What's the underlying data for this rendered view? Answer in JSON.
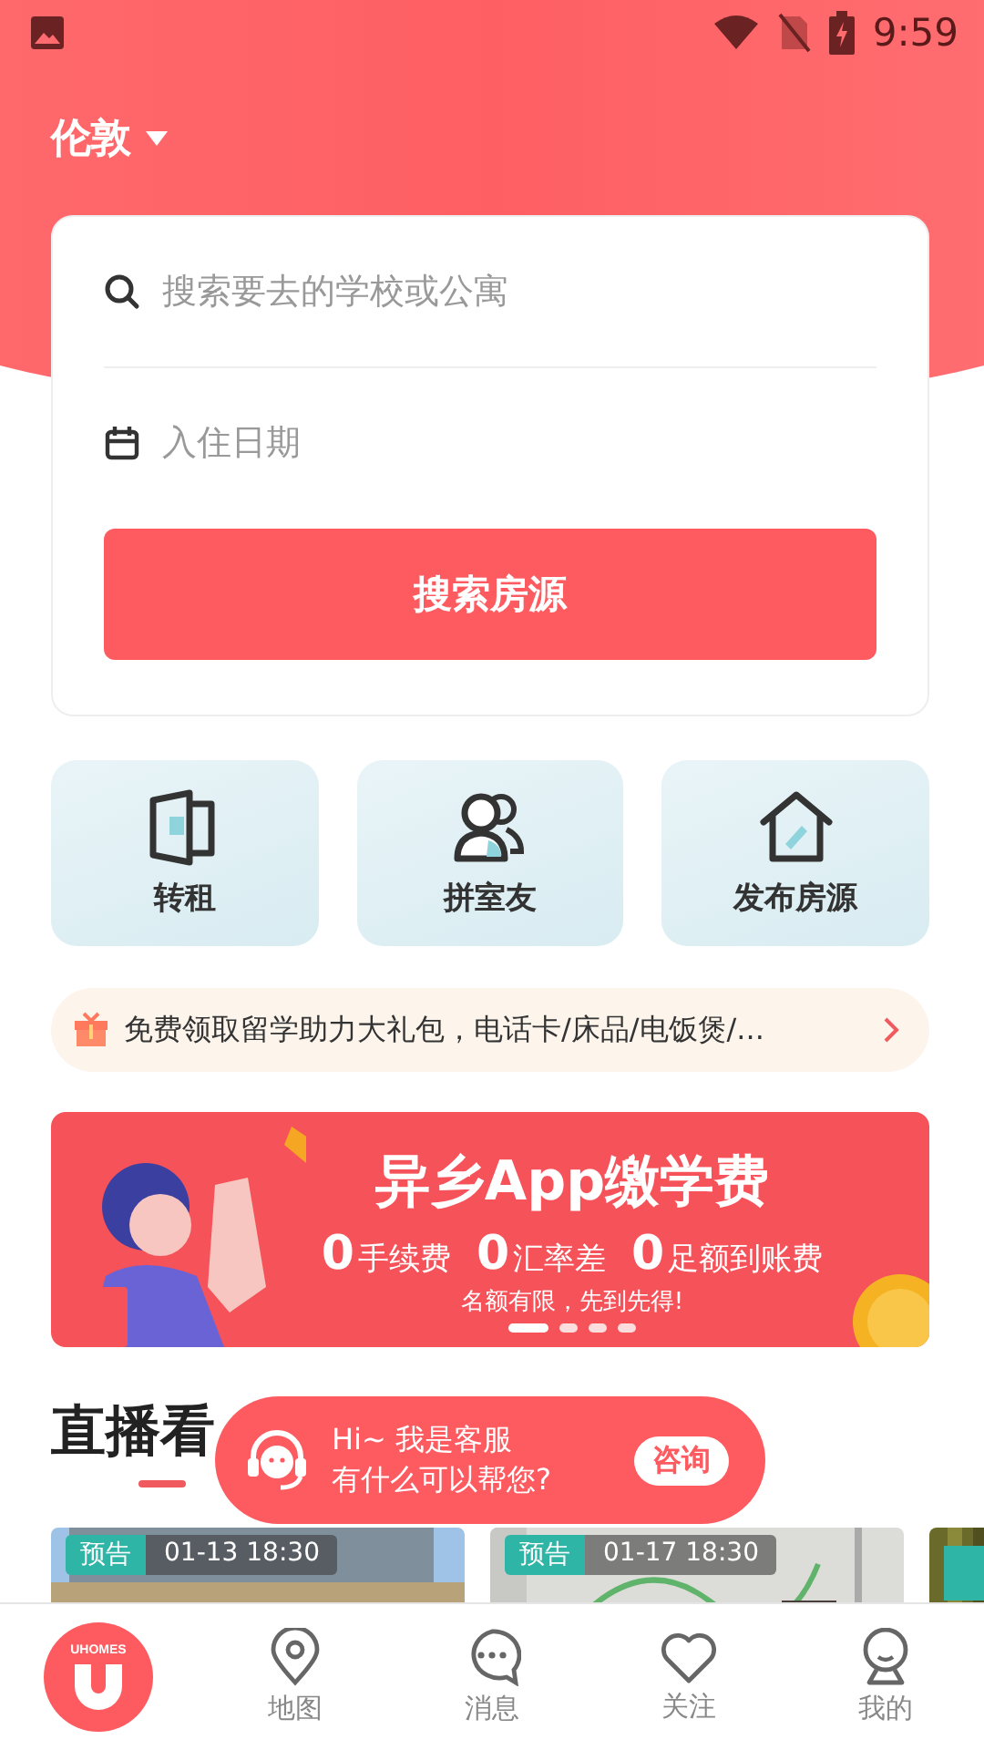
{
  "status_bar": {
    "time": "9:59"
  },
  "city": {
    "label": "伦敦"
  },
  "search": {
    "placeholder": "搜索要去的学校或公寓",
    "date_placeholder": "入住日期",
    "button": "搜索房源"
  },
  "shortcuts": [
    {
      "kind": "door",
      "label": "转租"
    },
    {
      "kind": "people",
      "label": "拼室友"
    },
    {
      "kind": "house",
      "label": "发布房源"
    }
  ],
  "notice": {
    "text": "免费领取留学助力大礼包，电话卡/床品/电饭煲/..."
  },
  "banner": {
    "title": "异乡App缴学费",
    "features": [
      {
        "zero": "0",
        "text": "手续费"
      },
      {
        "zero": "0",
        "text": "汇率差"
      },
      {
        "zero": "0",
        "text": "足额到账费"
      }
    ],
    "note": "名额有限，先到先得!",
    "dots": [
      {
        "selected": true
      },
      {
        "selected": false
      },
      {
        "selected": false
      },
      {
        "selected": false
      }
    ]
  },
  "section": {
    "title": "直播看"
  },
  "chat": {
    "line1": "Hi~ 我是客服",
    "line2": "有什么可以帮您?",
    "button": "咨询"
  },
  "live": [
    {
      "kind": "picture",
      "badge": "预告",
      "time": "01-13 18:30"
    },
    {
      "kind": "picture",
      "badge": "预告",
      "time": "01-17 18:30"
    },
    {
      "kind": "picture"
    }
  ],
  "nav": [
    {
      "kind": "logo",
      "label": "UHOMES",
      "selected": true
    },
    {
      "kind": "pin",
      "label": "地图",
      "selected": false
    },
    {
      "kind": "chat",
      "label": "消息",
      "selected": false
    },
    {
      "kind": "heart",
      "label": "关注",
      "selected": false
    },
    {
      "kind": "person",
      "label": "我的",
      "selected": false
    }
  ]
}
